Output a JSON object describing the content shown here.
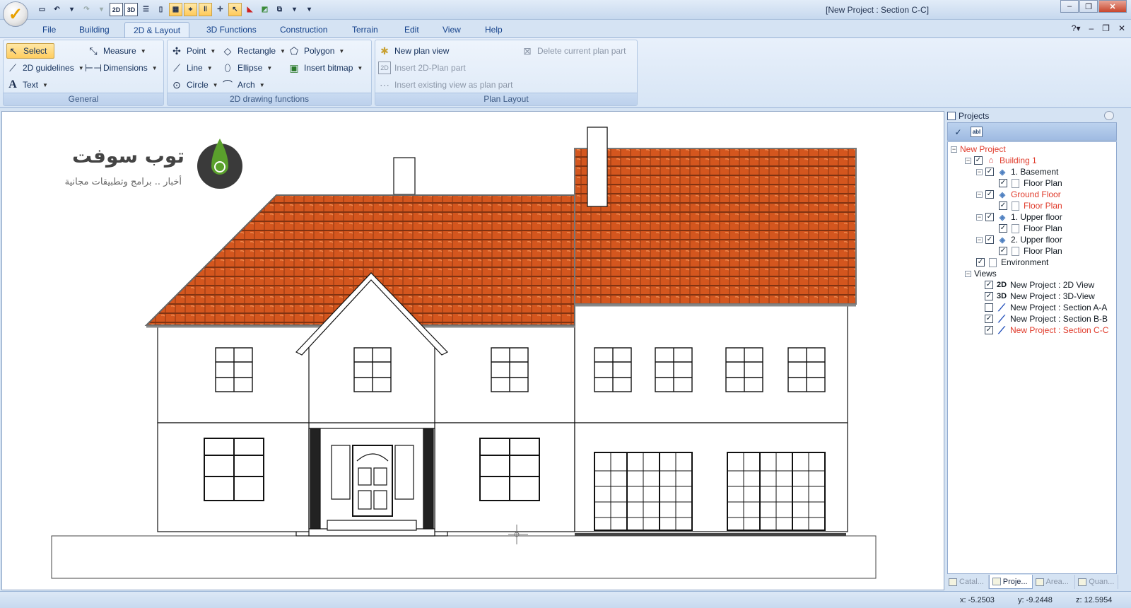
{
  "titlebar": {
    "title": "[New Project : Section C-C]",
    "quick_access": [
      "2D",
      "3D"
    ]
  },
  "menu": {
    "tabs": [
      "File",
      "Building",
      "2D & Layout",
      "3D Functions",
      "Construction",
      "Terrain",
      "Edit",
      "View",
      "Help"
    ],
    "active": "2D & Layout"
  },
  "ribbon": {
    "general": {
      "label": "General",
      "select": "Select",
      "guidelines": "2D guidelines",
      "text": "Text",
      "measure": "Measure",
      "dimensions": "Dimensions"
    },
    "drawing": {
      "label": "2D drawing functions",
      "point": "Point",
      "line": "Line",
      "circle": "Circle",
      "rectangle": "Rectangle",
      "ellipse": "Ellipse",
      "arch": "Arch",
      "polygon": "Polygon",
      "insert_bitmap": "Insert bitmap"
    },
    "layout": {
      "label": "Plan Layout",
      "new_plan_view": "New plan view",
      "insert_2d": "Insert 2D-Plan part",
      "insert_existing": "Insert existing view as plan part",
      "delete_current": "Delete current plan part"
    }
  },
  "watermark": {
    "title": "توب سوفت",
    "subtitle": "أخبار .. برامج وتطبيقات مجانية"
  },
  "projects_panel": {
    "title": "Projects",
    "toolbar_abl": "abl",
    "tree": {
      "root": "New Project",
      "building": "Building 1",
      "basement": "1. Basement",
      "basement_plan": "Floor Plan",
      "ground": "Ground Floor",
      "ground_plan": "Floor Plan",
      "upper1": "1. Upper floor",
      "upper1_plan": "Floor Plan",
      "upper2": "2. Upper floor",
      "upper2_plan": "Floor Plan",
      "environment": "Environment",
      "views": "Views",
      "view_2d_tag": "2D",
      "view_2d": "New Project : 2D View",
      "view_3d_tag": "3D",
      "view_3d": "New Project : 3D-View",
      "section_a": "New Project : Section A-A",
      "section_b": "New Project : Section B-B",
      "section_c": "New Project : Section C-C"
    },
    "tabs": [
      "Catal...",
      "Proje...",
      "Area...",
      "Quan..."
    ]
  },
  "status": {
    "x": "x: -5.2503",
    "y": "y: -9.2448",
    "z": "z: 12.5954"
  },
  "colors": {
    "roof_tile": "#d4561e",
    "selected_item": "#e03a2a",
    "ribbon_highlight": "#ffcd5f"
  }
}
